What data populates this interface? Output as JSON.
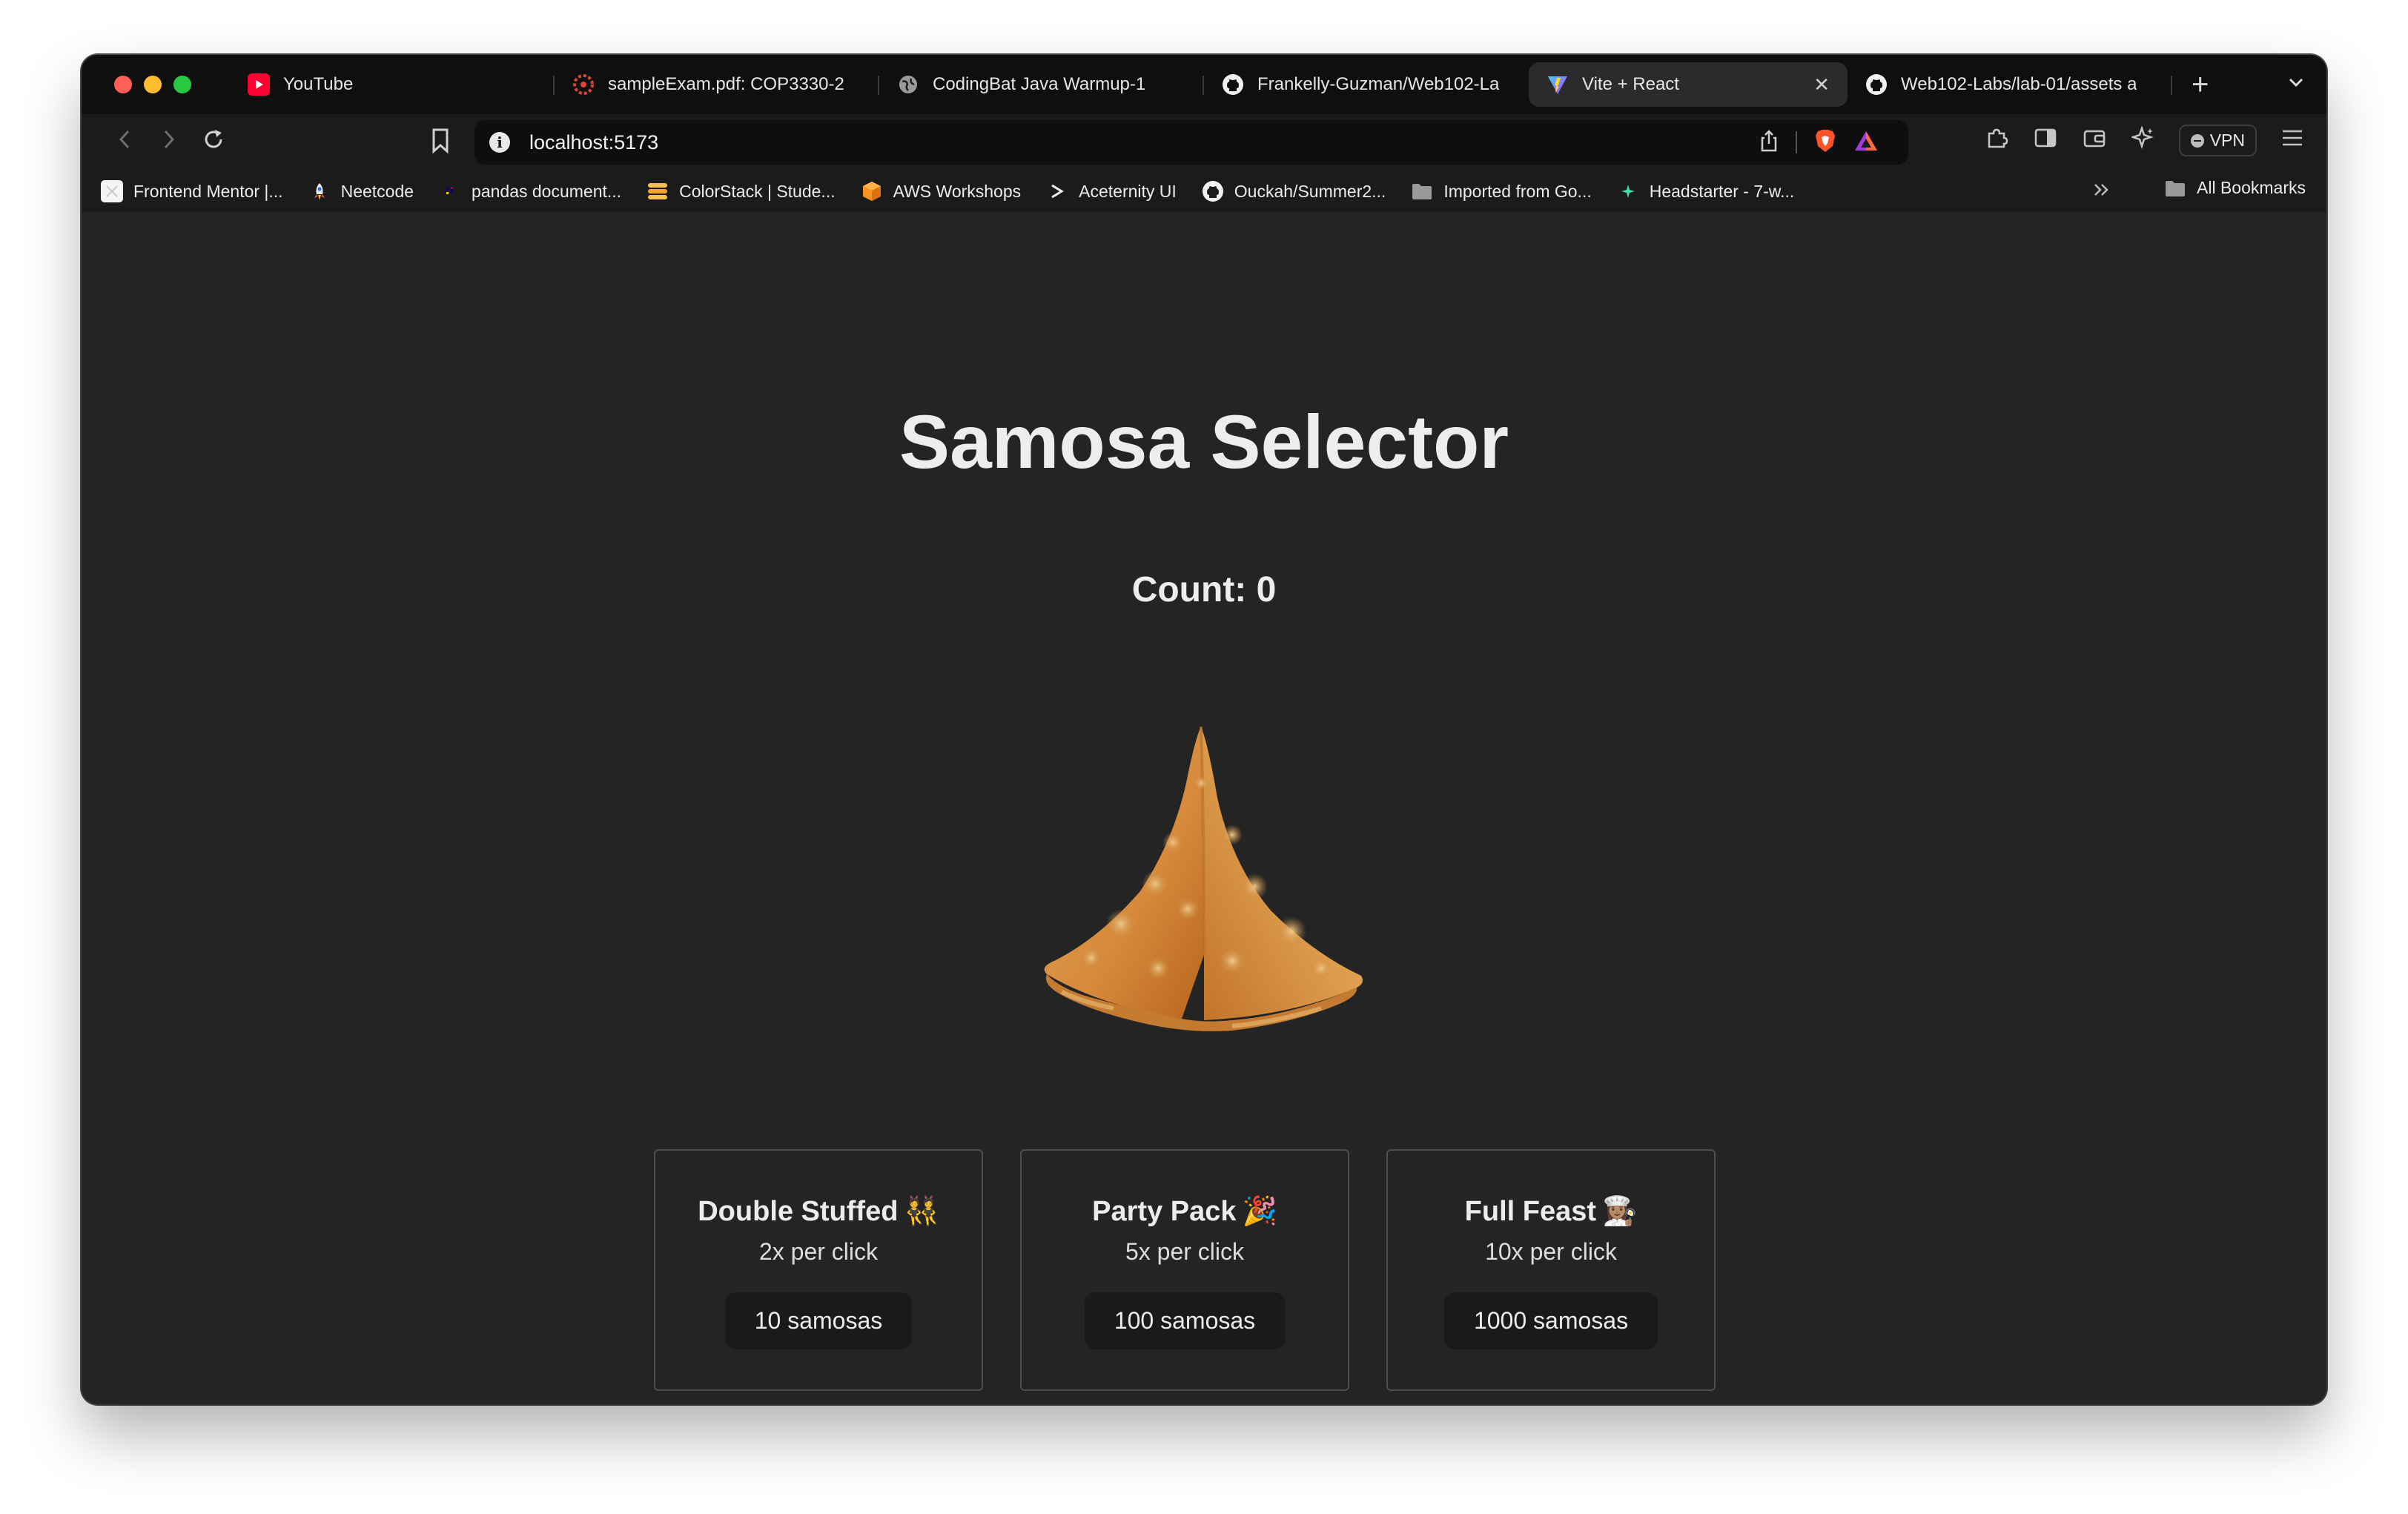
{
  "tabs": [
    {
      "label": "YouTube",
      "icon": "youtube-icon",
      "active": false
    },
    {
      "label": "sampleExam.pdf: COP3330-2",
      "icon": "ucf-icon",
      "active": false
    },
    {
      "label": "CodingBat Java Warmup-1",
      "icon": "globe-icon",
      "active": false
    },
    {
      "label": "Frankelly-Guzman/Web102-La",
      "icon": "github-icon",
      "active": false
    },
    {
      "label": "Vite + React",
      "icon": "vite-icon",
      "active": true
    },
    {
      "label": "Web102-Labs/lab-01/assets a",
      "icon": "github-icon",
      "active": false
    }
  ],
  "toolbar": {
    "url": "localhost:5173",
    "vpn_label": "VPN"
  },
  "bookmarks": [
    {
      "label": "Frontend Mentor |...",
      "icon": "frontend-mentor-icon"
    },
    {
      "label": "Neetcode",
      "icon": "rocket-icon"
    },
    {
      "label": "pandas document...",
      "icon": "pandas-icon"
    },
    {
      "label": "ColorStack | Stude...",
      "icon": "colorstack-icon"
    },
    {
      "label": "AWS Workshops",
      "icon": "aws-cube-icon"
    },
    {
      "label": "Aceternity UI",
      "icon": "aceternity-icon"
    },
    {
      "label": "Ouckah/Summer2...",
      "icon": "github-icon"
    },
    {
      "label": "Imported from Go...",
      "icon": "folder-icon"
    },
    {
      "label": "Headstarter - 7-w...",
      "icon": "headstarter-icon"
    }
  ],
  "all_bookmarks_label": "All Bookmarks",
  "app": {
    "title": "Samosa Selector",
    "count_label": "Count: 0",
    "samosa_image": "samosa-image",
    "upgrades": [
      {
        "title": "Double Stuffed",
        "emoji": "👯",
        "rate": "2x per click",
        "cost": "10 samosas"
      },
      {
        "title": "Party Pack",
        "emoji": "🎉",
        "rate": "5x per click",
        "cost": "100 samosas"
      },
      {
        "title": "Full Feast",
        "emoji": "👩🏽‍🍳",
        "rate": "10x per click",
        "cost": "1000 samosas"
      }
    ]
  },
  "colors": {
    "page_bg": "#242424",
    "text": "#ededed",
    "button_bg": "#1a1a1a",
    "card_border": "#4e4e4e"
  }
}
